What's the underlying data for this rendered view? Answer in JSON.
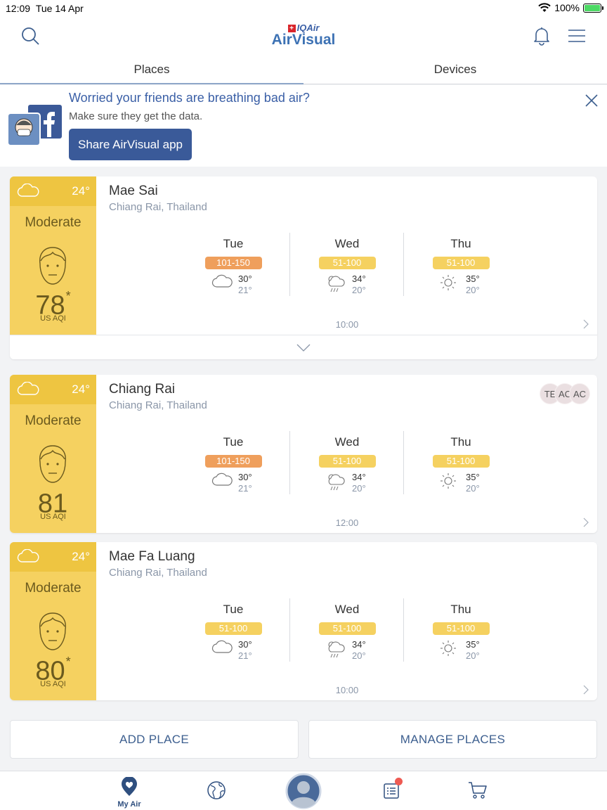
{
  "status_bar": {
    "time": "12:09",
    "date": "Tue 14 Apr",
    "battery": "100%"
  },
  "header": {
    "brand_top": "IQAir",
    "brand": "AirVisual",
    "brand_color": "#3d72b4"
  },
  "tabs": [
    {
      "label": "Places",
      "active": true
    },
    {
      "label": "Devices",
      "active": false
    }
  ],
  "banner": {
    "title": "Worried your friends are breathing bad air?",
    "subtitle": "Make sure they get the data.",
    "button": "Share AirVisual app"
  },
  "colors": {
    "moderate_panel": "#f5d160",
    "moderate_header": "#eec541",
    "pill_orange": "#ef9f5c",
    "pill_yellow": "#f5d160",
    "accent": "#3a5a99"
  },
  "places": [
    {
      "city": "Mae Sai",
      "region": "Chiang Rai, Thailand",
      "temp": "24°",
      "level": "Moderate",
      "aqi": "78",
      "aqi_mark": "*",
      "unit": "US AQI",
      "time": "10:00",
      "forecast": [
        {
          "day": "Tue",
          "range": "101-150",
          "hi": "30°",
          "lo": "21°",
          "icon": "cloud-icon",
          "color": "orange"
        },
        {
          "day": "Wed",
          "range": "51-100",
          "hi": "34°",
          "lo": "20°",
          "icon": "rain-icon",
          "color": "yellow"
        },
        {
          "day": "Thu",
          "range": "51-100",
          "hi": "35°",
          "lo": "20°",
          "icon": "sun-icon",
          "color": "yellow"
        }
      ]
    },
    {
      "city": "Chiang Rai",
      "region": "Chiang Rai, Thailand",
      "temp": "24°",
      "level": "Moderate",
      "aqi": "81",
      "aqi_mark": "",
      "unit": "US AQI",
      "time": "12:00",
      "badges": [
        "TE",
        "AC",
        "AC"
      ],
      "forecast": [
        {
          "day": "Tue",
          "range": "101-150",
          "hi": "30°",
          "lo": "21°",
          "icon": "cloud-icon",
          "color": "orange"
        },
        {
          "day": "Wed",
          "range": "51-100",
          "hi": "34°",
          "lo": "20°",
          "icon": "rain-icon",
          "color": "yellow"
        },
        {
          "day": "Thu",
          "range": "51-100",
          "hi": "35°",
          "lo": "20°",
          "icon": "sun-icon",
          "color": "yellow"
        }
      ]
    },
    {
      "city": "Mae Fa Luang",
      "region": "Chiang Rai, Thailand",
      "temp": "24°",
      "level": "Moderate",
      "aqi": "80",
      "aqi_mark": "*",
      "unit": "US AQI",
      "time": "10:00",
      "forecast": [
        {
          "day": "Tue",
          "range": "51-100",
          "hi": "30°",
          "lo": "21°",
          "icon": "cloud-icon",
          "color": "yellow"
        },
        {
          "day": "Wed",
          "range": "51-100",
          "hi": "34°",
          "lo": "20°",
          "icon": "rain-icon",
          "color": "yellow"
        },
        {
          "day": "Thu",
          "range": "51-100",
          "hi": "35°",
          "lo": "20°",
          "icon": "sun-icon",
          "color": "yellow"
        }
      ]
    }
  ],
  "actions": {
    "add": "ADD PLACE",
    "manage": "MANAGE PLACES"
  },
  "tabbar": {
    "my_air": "My Air"
  }
}
